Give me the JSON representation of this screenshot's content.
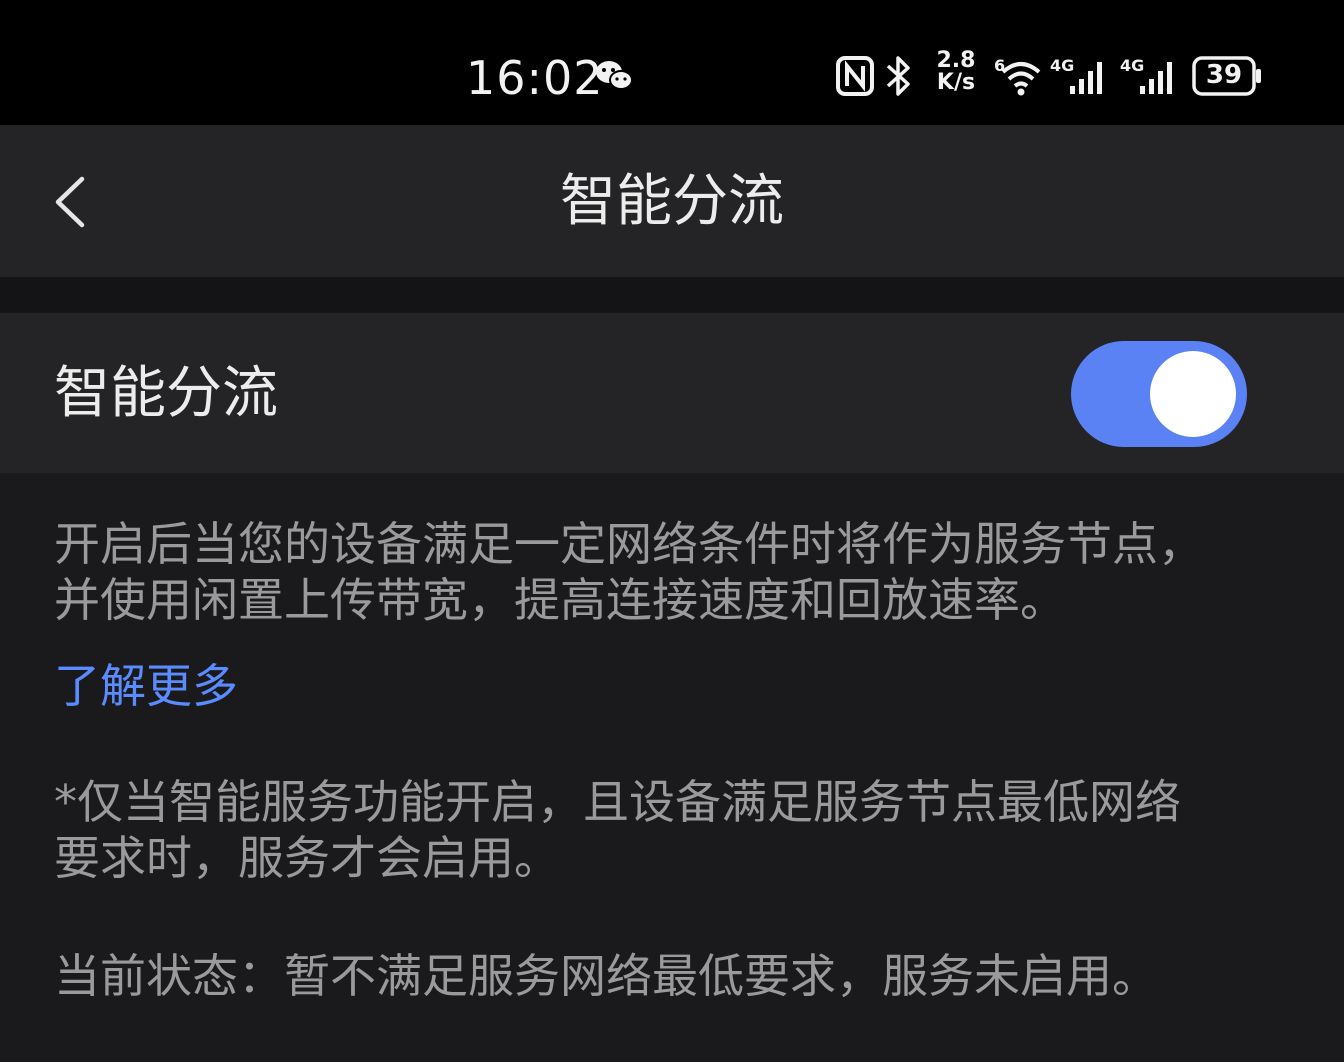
{
  "status_bar": {
    "time": "16:02",
    "network_speed_value": "2.8",
    "network_speed_unit": "K/s",
    "wifi_label": "6",
    "signal_1_label": "4G",
    "signal_2_label": "4G",
    "battery_level": "39",
    "icons": [
      "wechat-icon",
      "nfc-icon",
      "bluetooth-icon",
      "wifi-icon",
      "signal-icon",
      "signal-icon",
      "battery-icon"
    ]
  },
  "header": {
    "title": "智能分流",
    "back_icon": "chevron-left-icon"
  },
  "setting": {
    "label": "智能分流",
    "enabled": true,
    "accent_color": "#5a82f4"
  },
  "description": {
    "line1": "开启后当您的设备满足一定网络条件时将作为服务节点，",
    "line2": "并使用闲置上传带宽，提高连接速度和回放速率。",
    "learn_more": "了解更多",
    "note_line1": "*仅当智能服务功能开启，且设备满足服务节点最低网络",
    "note_line2": "要求时，服务才会启用。",
    "status": "当前状态：暂不满足服务网络最低要求，服务未启用。"
  }
}
